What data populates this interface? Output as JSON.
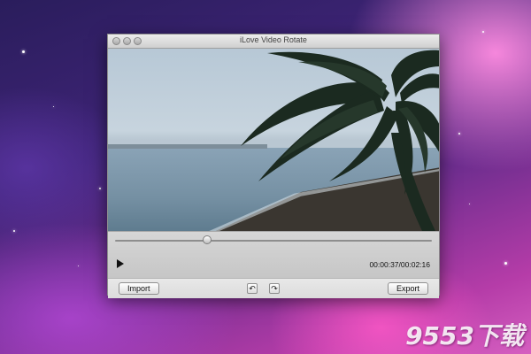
{
  "window": {
    "title": "iLove Video Rotate"
  },
  "player": {
    "progress_fraction": 0.29,
    "current_time": "00:00:37",
    "separator": "/",
    "total_time": "00:02:16",
    "play_icon": "play-icon"
  },
  "toolbar": {
    "import_label": "Import",
    "export_label": "Export",
    "rotate_left_icon": "rotate-left-icon",
    "rotate_right_icon": "rotate-right-icon"
  },
  "desktop": {
    "watermark": "9553下载"
  },
  "colors": {
    "desktop_purple": "#3f2477",
    "desktop_pink": "#d55fc0",
    "window_chrome": "#e3e3e3"
  }
}
